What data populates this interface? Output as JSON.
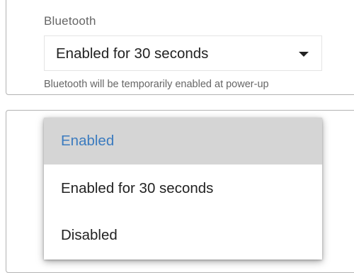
{
  "bluetooth": {
    "label": "Bluetooth",
    "selected_value": "Enabled for 30 seconds",
    "helper_text": "Bluetooth will be temporarily enabled at power-up",
    "options": [
      "Enabled",
      "Enabled for 30 seconds",
      "Disabled"
    ],
    "highlighted_option": "Enabled"
  },
  "colors": {
    "highlight_bg": "#d5d5d5",
    "highlight_text": "#3b7bbf",
    "text": "#222222",
    "muted_text": "#666666"
  },
  "icons": {
    "dropdown": "caret-down-icon"
  }
}
